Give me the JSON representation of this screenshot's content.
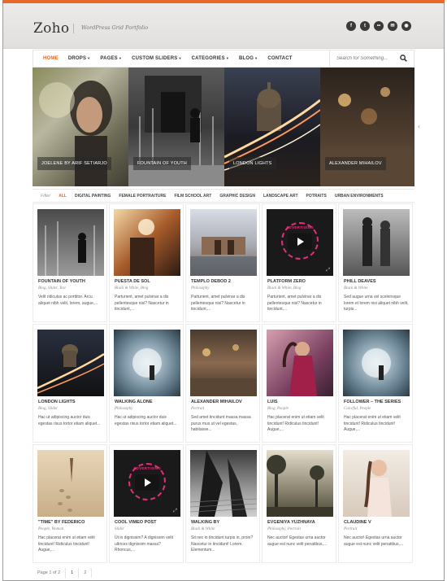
{
  "site": {
    "logo": "Zoho",
    "tagline": "WordPress Grid Portfolio",
    "social": [
      {
        "icon": "facebook-icon",
        "glyph": "f"
      },
      {
        "icon": "twitter-icon",
        "glyph": "t"
      },
      {
        "icon": "flickr-icon",
        "glyph": "••"
      },
      {
        "icon": "email-icon",
        "glyph": "✉"
      },
      {
        "icon": "rss-icon",
        "glyph": "◉"
      }
    ]
  },
  "nav": {
    "items": [
      {
        "label": "HOME",
        "dropdown": false,
        "active": true
      },
      {
        "label": "DROPS",
        "dropdown": true
      },
      {
        "label": "PAGES",
        "dropdown": true
      },
      {
        "label": "CUSTOM SLIDERS",
        "dropdown": true
      },
      {
        "label": "CATEGORIES",
        "dropdown": true
      },
      {
        "label": "BLOG",
        "dropdown": true
      },
      {
        "label": "CONTACT",
        "dropdown": false
      }
    ],
    "search_placeholder": "Search for Something..."
  },
  "slider": {
    "slides": [
      {
        "caption": "JOELENE BY ARIF SETIARJO"
      },
      {
        "caption": "FOUNTAIN OF YOUTH"
      },
      {
        "caption": "LONDON LIGHTS"
      },
      {
        "caption": "ALEXANDER MIHAILOV"
      }
    ]
  },
  "filters": {
    "label": "Filter",
    "items": [
      "ALL",
      "DIGITAL PAINTING",
      "FEMALE PORTRAITURE",
      "FILM SCHOOL ART",
      "GRAPHIC DESIGN",
      "LANDSCAPE ART",
      "POTRAITS",
      "URBAN ENVIRONMENTS"
    ],
    "active": "ALL"
  },
  "portfolio": [
    {
      "title": "FOUNTAIN OF YOUTH",
      "cats": "Blog, Slider, Test",
      "excerpt": "Velit ridiculus ac porttitor. Arcu aliquet nibh velit, lorem, augue,..."
    },
    {
      "title": "PUESTA DE SOL",
      "cats": "Black & White, Blog",
      "excerpt": "Parturient, amet pulvinar a dis pellentesque nisi? Nascetur in tincidunt,..."
    },
    {
      "title": "TEMPLO DEBOD 2",
      "cats": "Philosophy",
      "excerpt": "Parturient, amet pulvinar a dis pellentesque nisi? Nascetur in tincidunt,..."
    },
    {
      "title": "PLATFORM ZERO",
      "cats": "Black & White, Blog",
      "excerpt": "Parturient, amet pulvinar a dis pellentesque nisi? Nascetur in tincidunt,..."
    },
    {
      "title": "PHILL DEAVES",
      "cats": "Black & White",
      "excerpt": "Sed augue urna vel scelerisque lorem et lorem nisi aliquet nibh velit, turpis..."
    },
    {
      "title": "LONDON LIGHTS",
      "cats": "Blog, Slider",
      "excerpt": "Hac ut adipiscing auctor duis egestas risus tortor etiam aliquet..."
    },
    {
      "title": "WALKING ALONE",
      "cats": "Philosophy",
      "excerpt": "Hac ut adipiscing auctor duis egestas risus tortor etiam aliquet..."
    },
    {
      "title": "ALEXANDER MIHAILOV",
      "cats": "Portrait",
      "excerpt": "Sed amet tincidunt massa massa purus mus ut vel egestas, habitasse..."
    },
    {
      "title": "LUIS",
      "cats": "Blog, People",
      "excerpt": "Hac placerat enim ut etiam velit tincidunt! Ridiculus tincidunt! Augue,..."
    },
    {
      "title": "FOLLOWER – THE SERIES",
      "cats": "Colorful, People",
      "excerpt": "Hac placerat enim ut etiam velit tincidunt! Ridiculus tincidunt! Augue,..."
    },
    {
      "title": "\"TIME\" BY FEDERICO",
      "cats": "People, Woman",
      "excerpt": "Hac placerat enim ut etiam velit tincidunt! Ridiculus tincidunt! Augue,..."
    },
    {
      "title": "COOL VIMEO POST",
      "cats": "Slider",
      "excerpt": "Ut in dignissim? A dignissim velit ultrices dignissim massa? Rhoncus,..."
    },
    {
      "title": "WALKING BY",
      "cats": "Black & White",
      "excerpt": "Sit nec in tincidunt turpis in, proin? Nascetur in tincidunt! Lorem. Elementum..."
    },
    {
      "title": "EVGENIYA YUZHNAYA",
      "cats": "Philosophy, Portrait",
      "excerpt": "Nec auctor! Egestas urna auctor augue est nunc velit penatibus,..."
    },
    {
      "title": "CLAUDINE V",
      "cats": "Portrait",
      "excerpt": "Nec auctor! Egestas urna auctor augue est nunc velit penatibus,..."
    }
  ],
  "video_badge": "ADVERTISING",
  "pagination": {
    "label": "Page 1 of 2",
    "pages": [
      "1",
      "2"
    ]
  }
}
